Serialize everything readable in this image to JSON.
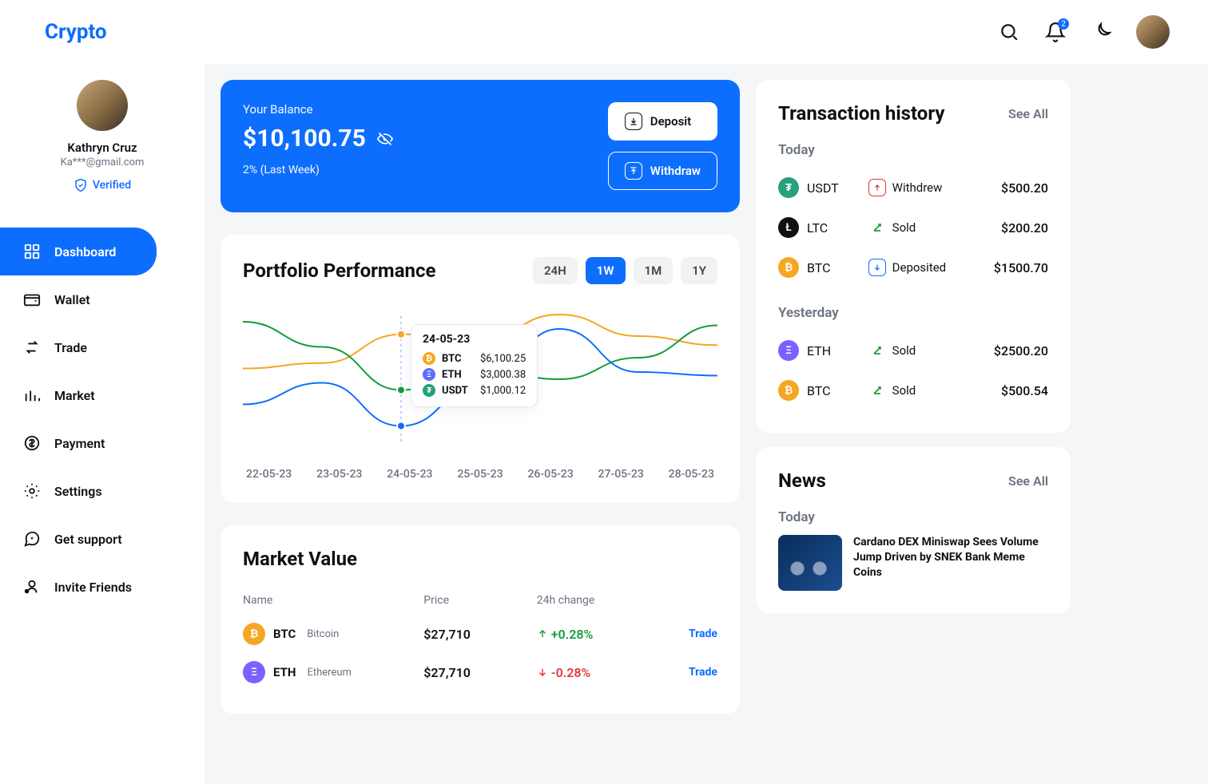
{
  "brand": "Crypto",
  "notif_count": "2",
  "profile": {
    "name": "Kathryn Cruz",
    "email": "Ka***@gmail.com",
    "verified_label": "Verified"
  },
  "nav": [
    "Dashboard",
    "Wallet",
    "Trade",
    "Market",
    "Payment",
    "Settings",
    "Get support",
    "Invite Friends"
  ],
  "balance": {
    "label": "Your Balance",
    "amount": "$10,100.75",
    "change": "2% (Last Week)",
    "deposit": "Deposit",
    "withdraw": "Withdraw"
  },
  "portfolio": {
    "title": "Portfolio Performance",
    "ranges": [
      "24H",
      "1W",
      "1M",
      "1Y"
    ],
    "active_range": "1W",
    "xaxis": [
      "22-05-23",
      "23-05-23",
      "24-05-23",
      "25-05-23",
      "26-05-23",
      "27-05-23",
      "28-05-23"
    ],
    "tooltip": {
      "date": "24-05-23",
      "rows": [
        {
          "symbol": "BTC",
          "value": "$6,100.25",
          "color": "#f5a623"
        },
        {
          "symbol": "ETH",
          "value": "$3,000.38",
          "color": "#5b6dff"
        },
        {
          "symbol": "USDT",
          "value": "$1,000.12",
          "color": "#26a17b"
        }
      ]
    }
  },
  "market": {
    "title": "Market Value",
    "headers": {
      "name": "Name",
      "price": "Price",
      "change": "24h change"
    },
    "rows": [
      {
        "symbol": "BTC",
        "name": "Bitcoin",
        "price": "$27,710",
        "change": "+0.28%",
        "trend": "up",
        "color": "#f5a623",
        "trade": "Trade"
      },
      {
        "symbol": "ETH",
        "name": "Ethereum",
        "price": "$27,710",
        "change": "-0.28%",
        "trend": "down",
        "color": "#7b61ff",
        "trade": "Trade"
      }
    ]
  },
  "transactions": {
    "title": "Transaction history",
    "seeall": "See All",
    "groups": [
      {
        "label": "Today",
        "items": [
          {
            "symbol": "USDT",
            "color": "#26a17b",
            "action": "Withdrew",
            "action_type": "withdrew",
            "amount": "$500.20"
          },
          {
            "symbol": "LTC",
            "color": "#111111",
            "action": "Sold",
            "action_type": "sold",
            "amount": "$200.20"
          },
          {
            "symbol": "BTC",
            "color": "#f5a623",
            "action": "Deposited",
            "action_type": "deposited",
            "amount": "$1500.70"
          }
        ]
      },
      {
        "label": "Yesterday",
        "items": [
          {
            "symbol": "ETH",
            "color": "#7b61ff",
            "action": "Sold",
            "action_type": "sold",
            "amount": "$2500.20"
          },
          {
            "symbol": "BTC",
            "color": "#f5a623",
            "action": "Sold",
            "action_type": "sold",
            "amount": "$500.54"
          }
        ]
      }
    ]
  },
  "news": {
    "title": "News",
    "seeall": "See All",
    "group_label": "Today",
    "item_title": "Cardano DEX Miniswap Sees Volume Jump Driven by SNEK Bank Meme Coins"
  },
  "chart_data": {
    "type": "line",
    "xlabel": "",
    "ylabel": "",
    "categories": [
      "22-05-23",
      "23-05-23",
      "24-05-23",
      "25-05-23",
      "26-05-23",
      "27-05-23",
      "28-05-23"
    ],
    "series": [
      {
        "name": "BTC",
        "color": "#f5a623",
        "values": [
          4200,
          4500,
          6100.25,
          5800,
          7200,
          6000,
          5500
        ]
      },
      {
        "name": "ETH",
        "color": "#0f9d3b",
        "values": [
          6800,
          5400,
          3000.38,
          4200,
          3600,
          4800,
          6600
        ]
      },
      {
        "name": "USDT",
        "color": "#0d6efd",
        "values": [
          2200,
          3400,
          1000.12,
          3200,
          6400,
          4000,
          3800
        ]
      }
    ],
    "ylim": [
      0,
      8000
    ]
  }
}
